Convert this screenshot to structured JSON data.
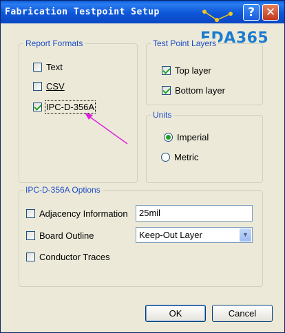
{
  "window": {
    "title": "Fabrication Testpoint Setup"
  },
  "watermark": {
    "text": "EDA365"
  },
  "report_formats": {
    "legend": "Report Formats",
    "items": [
      {
        "label": "Text",
        "checked": false
      },
      {
        "label": "CSV",
        "checked": false
      },
      {
        "label": "IPC-D-356A",
        "checked": true
      }
    ]
  },
  "test_point_layers": {
    "legend": "Test Point Layers",
    "items": [
      {
        "label": "Top layer",
        "checked": true
      },
      {
        "label": "Bottom layer",
        "checked": true
      }
    ]
  },
  "units": {
    "legend": "Units",
    "options": [
      {
        "label": "Imperial",
        "selected": true
      },
      {
        "label": "Metric",
        "selected": false
      }
    ]
  },
  "ipc_options": {
    "legend": "IPC-D-356A Options",
    "adjacency_label": "Adjacency Information",
    "adjacency_value": "25mil",
    "board_outline_label": "Board Outline",
    "board_outline_value": "Keep-Out Layer",
    "conductor_traces_label": "Conductor Traces"
  },
  "buttons": {
    "ok": "OK",
    "cancel": "Cancel"
  },
  "colors": {
    "title_bar": "#0a5ed8",
    "dialog_bg": "#ece9d8",
    "legend_text": "#1f4fc8",
    "check": "#21a121",
    "annotation_arrow": "#e020e0",
    "watermark": "#1b7ccf"
  },
  "icons": [
    "help-icon",
    "close-icon",
    "chevron-down-icon",
    "checkmark-icon",
    "arrow-annotation-icon"
  ]
}
